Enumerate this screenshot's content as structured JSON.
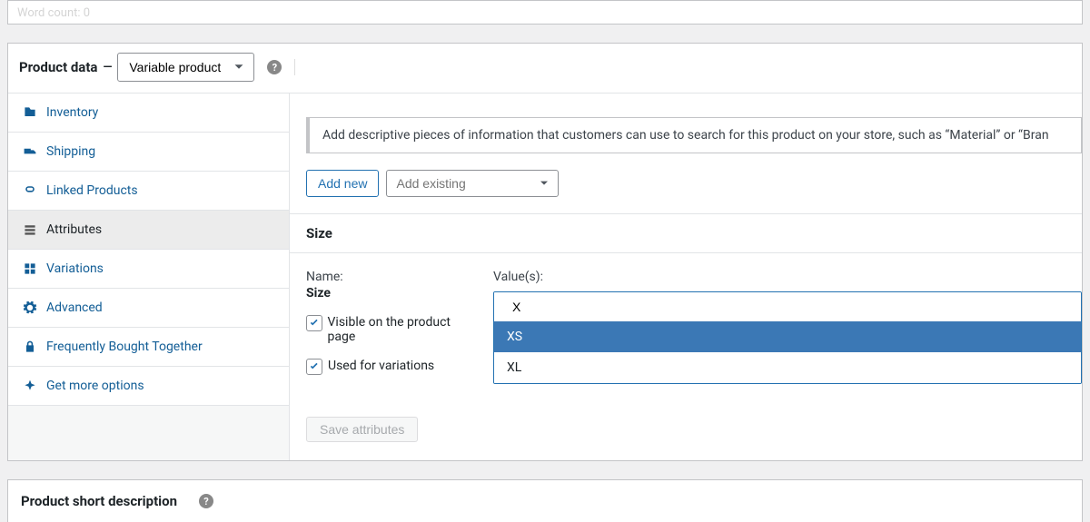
{
  "word_count_label": "Word count: 0",
  "product_data": {
    "title": "Product data",
    "type_selected": "Variable product"
  },
  "tabs": [
    {
      "id": "inventory",
      "label": "Inventory"
    },
    {
      "id": "shipping",
      "label": "Shipping"
    },
    {
      "id": "linked",
      "label": "Linked Products"
    },
    {
      "id": "attributes",
      "label": "Attributes"
    },
    {
      "id": "variations",
      "label": "Variations"
    },
    {
      "id": "advanced",
      "label": "Advanced"
    },
    {
      "id": "fbt",
      "label": "Frequently Bought Together"
    },
    {
      "id": "more",
      "label": "Get more options"
    }
  ],
  "info_text": "Add descriptive pieces of information that customers can use to search for this product on your store, such as “Material” or “Bran",
  "add_new_label": "Add new",
  "add_existing_placeholder": "Add existing",
  "attribute": {
    "heading": "Size",
    "name_label": "Name:",
    "name_value": "Size",
    "visible_label": "Visible on the product page",
    "visible_checked": true,
    "used_label": "Used for variations",
    "used_checked": true,
    "values_label": "Value(s):",
    "search_value": "X",
    "options": [
      {
        "label": "XS",
        "highlight": true
      },
      {
        "label": "XL",
        "highlight": false
      }
    ]
  },
  "save_label": "Save attributes",
  "short_desc_title": "Product short description"
}
